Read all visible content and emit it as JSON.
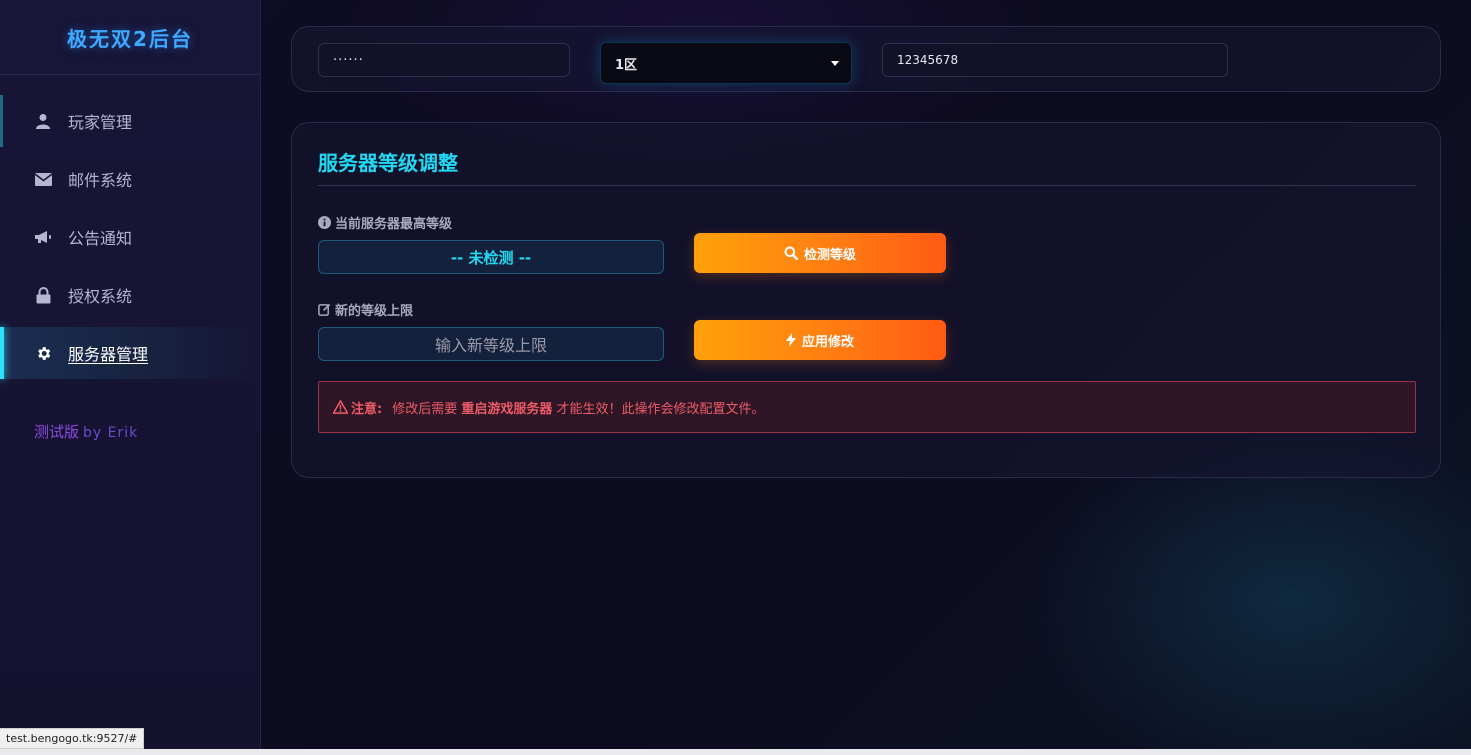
{
  "brand": {
    "title": "极无双2后台"
  },
  "sidebar": {
    "items": [
      {
        "label": "玩家管理",
        "icon": "user-icon"
      },
      {
        "label": "邮件系统",
        "icon": "mail-icon"
      },
      {
        "label": "公告通知",
        "icon": "megaphone-icon"
      },
      {
        "label": "授权系统",
        "icon": "lock-icon"
      },
      {
        "label": "服务器管理",
        "icon": "gear-icon",
        "active": true
      }
    ],
    "version": {
      "label": "测试版",
      "by": "by Erik"
    }
  },
  "topbar": {
    "password_value": "······",
    "server_select_value": "1区",
    "uid_value": "12345678"
  },
  "server_level": {
    "title": "服务器等级调整",
    "current_label": "当前服务器最高等级",
    "current_value": "-- 未检测 --",
    "detect_button": "检测等级",
    "new_label": "新的等级上限",
    "new_placeholder": "输入新等级上限",
    "apply_button": "应用修改",
    "notice": {
      "label": "注意:",
      "text_before": "修改后需要",
      "emphasis": "重启游戏服务器",
      "text_after": "才能生效！此操作会修改配置文件。"
    }
  },
  "status_bar": {
    "url": "test.bengogo.tk:9527/#"
  },
  "colors": {
    "accent_cyan": "#22d8f2",
    "button_orange": "#ff8a10",
    "alert_red": "#ef5a68",
    "version_purple": "#8a4de0"
  }
}
